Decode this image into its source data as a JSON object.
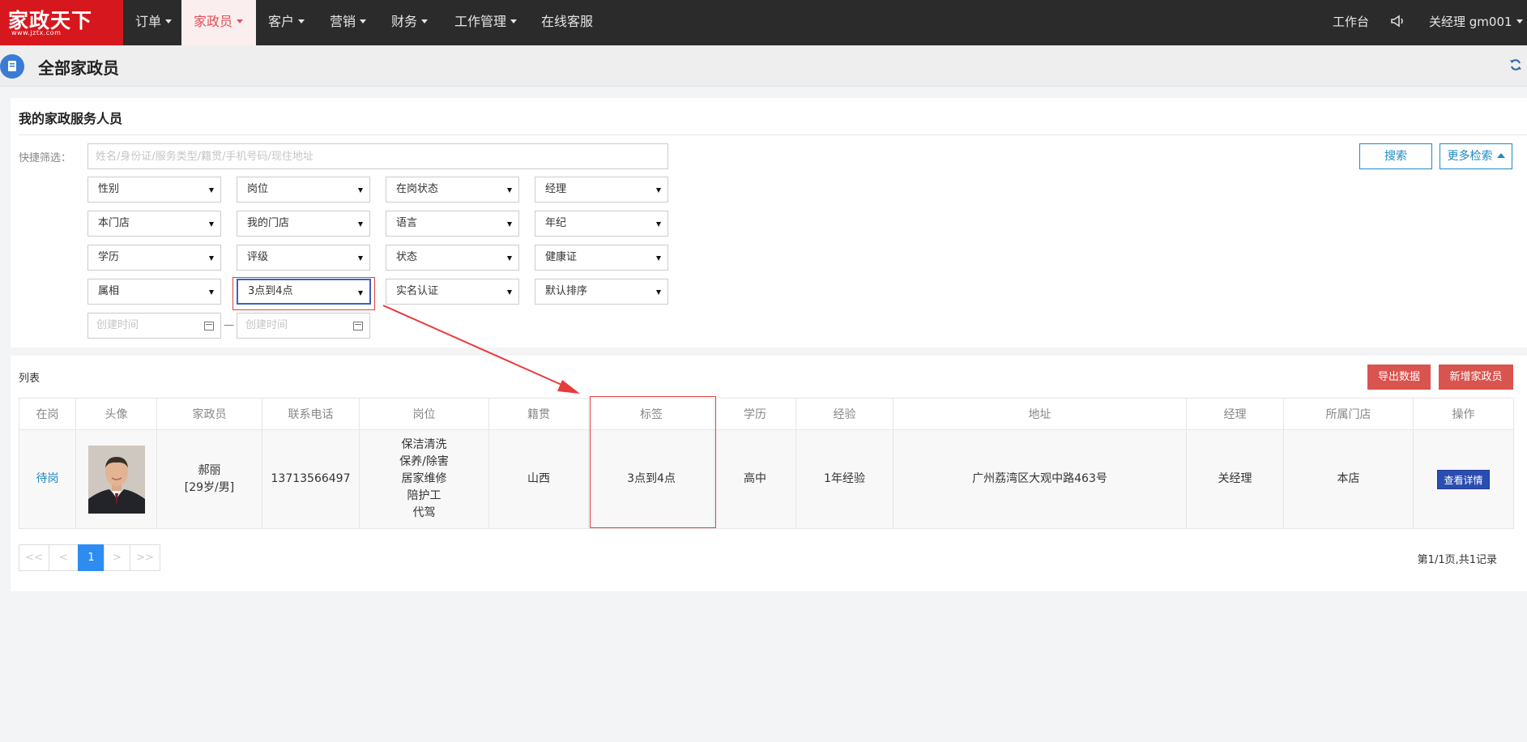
{
  "topnav": {
    "logo_text": "家政天下",
    "logo_sub": "www.jztx.com",
    "items": [
      {
        "label": "订单",
        "caret": true
      },
      {
        "label": "家政员",
        "caret": true,
        "active": true
      },
      {
        "label": "客户",
        "caret": true
      },
      {
        "label": "营销",
        "caret": true
      },
      {
        "label": "财务",
        "caret": true
      },
      {
        "label": "工作管理",
        "caret": true
      },
      {
        "label": "在线客服",
        "caret": false
      }
    ],
    "workbench": "工作台",
    "user": "关经理 gm001",
    "user_caret": true
  },
  "page": {
    "title": "全部家政员"
  },
  "filter": {
    "title": "我的家政服务人员",
    "quick_label": "快捷筛选：",
    "quick_placeholder": "姓名/身份证/服务类型/籍贯/手机号码/现住地址",
    "selects": [
      [
        "性别",
        "岗位",
        "在岗状态",
        "经理"
      ],
      [
        "本门店",
        "我的门店",
        "语言",
        "年纪"
      ],
      [
        "学历",
        "评级",
        "状态",
        "健康证"
      ],
      [
        "属相",
        "3点到4点",
        "实名认证",
        "默认排序"
      ]
    ],
    "date_from_placeholder": "创建时间",
    "date_to_placeholder": "创建时间",
    "date_separator": "—",
    "search_button": "搜索",
    "more_button": "更多检索"
  },
  "list": {
    "label": "列表",
    "export_button": "导出数据",
    "add_button": "新增家政员",
    "columns": [
      "在岗",
      "头像",
      "家政员",
      "联系电话",
      "岗位",
      "籍贯",
      "标签",
      "学历",
      "经验",
      "地址",
      "经理",
      "所属门店",
      "操作"
    ],
    "rows": [
      {
        "status": "待岗",
        "name": "郝丽",
        "info": "[29岁/男]",
        "phone": "13713566497",
        "positions": [
          "保洁清洗",
          "保养/除害",
          "居家维修",
          "陪护工",
          "代驾"
        ],
        "hometown": "山西",
        "tag": "3点到4点",
        "education": "高中",
        "experience": "1年经验",
        "address": "广州荔湾区大观中路463号",
        "manager": "关经理",
        "store": "本店",
        "action": "查看详情"
      }
    ]
  },
  "pager": {
    "first": "<<",
    "prev": "<",
    "current": "1",
    "next": ">",
    "last": ">>",
    "info": "第1/1页,共1记录"
  },
  "colors": {
    "logo_bg": "#d7171e",
    "nav_bg": "#2b2b2b",
    "accent_blue": "#1e8bc3",
    "danger": "#d9534f",
    "annotation": "#e04040"
  }
}
